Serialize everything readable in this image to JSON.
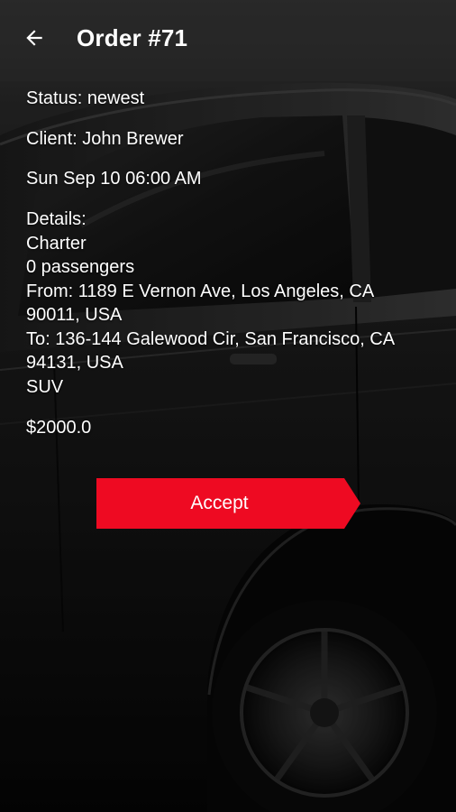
{
  "header": {
    "title": "Order #71",
    "back_icon": "arrow-left-icon"
  },
  "order": {
    "status": "Status: newest",
    "client": "Client: John Brewer",
    "datetime": "Sun Sep 10 06:00 AM",
    "details_label": "Details:",
    "service": "Charter",
    "passengers": "0 passengers",
    "from_line1": "From: 1189 E Vernon Ave, Los Angeles, CA",
    "from_line2": "90011, USA",
    "to_line1": "To: 136-144 Galewood Cir, San Francisco, CA",
    "to_line2": "94131, USA",
    "vehicle": "SUV",
    "price": "$2000.0"
  },
  "actions": {
    "accept_label": "Accept"
  },
  "colors": {
    "accent": "#ee0a22",
    "background": "#0d0d0d",
    "text": "#ffffff"
  }
}
